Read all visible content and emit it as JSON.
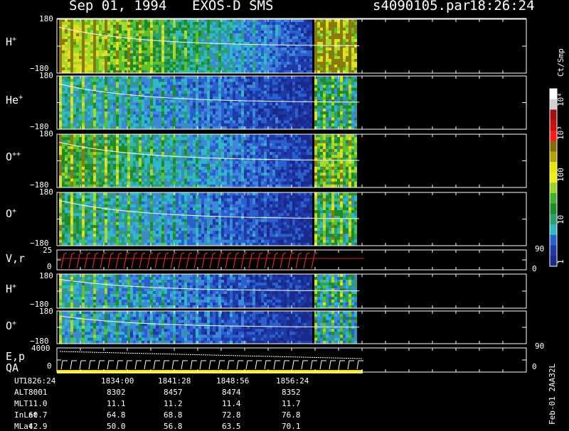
{
  "header": {
    "date": "Sep 01, 1994",
    "instrument": "EXOS-D SMS",
    "file": "s4090105.par",
    "time": "18:26:24"
  },
  "panels": [
    {
      "label": "H",
      "sup": "+",
      "top": "180",
      "bottom": "−180"
    },
    {
      "label": "He",
      "sup": "+",
      "top": "180",
      "bottom": "−180"
    },
    {
      "label": "O",
      "sup": "++",
      "top": "180",
      "bottom": "−180"
    },
    {
      "label": "O",
      "sup": "+",
      "top": "180",
      "bottom": "−180"
    },
    {
      "label": "V,r",
      "sup": "",
      "top": "25",
      "bottom": "0",
      "right_top": "90",
      "right_bottom": "0"
    },
    {
      "label": "H",
      "sup": "+",
      "top": "180",
      "bottom": "−180"
    },
    {
      "label": "O",
      "sup": "+",
      "top": "180",
      "bottom": "−180"
    },
    {
      "label": "E,p",
      "sup": "",
      "top": "4000",
      "bottom": "0",
      "right_top": "90",
      "right_bottom": "0"
    }
  ],
  "qa_label": "QA",
  "colorbar": {
    "unit": "Ct/Smp",
    "ticks": [
      "10⁴",
      "10³",
      "100",
      "10",
      "1"
    ]
  },
  "footer": {
    "rows": [
      {
        "name": "UT",
        "values": [
          "1826:24",
          "1834:00",
          "1841:28",
          "1848:56",
          "1856:24"
        ]
      },
      {
        "name": "ALT",
        "values": [
          "8001",
          "8302",
          "8457",
          "8474",
          "8352"
        ]
      },
      {
        "name": "MLT",
        "values": [
          "11.0",
          "11.1",
          "11.2",
          "11.4",
          "11.7"
        ]
      },
      {
        "name": "InLat",
        "values": [
          "60.7",
          "64.8",
          "68.8",
          "72.8",
          "76.8"
        ]
      },
      {
        "name": "MLat",
        "values": [
          "42.9",
          "50.0",
          "56.8",
          "63.5",
          "70.1"
        ]
      }
    ],
    "stamp": "Feb-01 2AA32L"
  },
  "chart_data": {
    "type": "heatmap",
    "title": "Sep 01, 1994   EXOS-D SMS",
    "x_ticks": [
      "1826:24",
      "1834:00",
      "1841:28",
      "1848:56",
      "1856:24"
    ],
    "colorscale": {
      "unit": "Ct/Smp",
      "range": [
        1,
        10000
      ],
      "scale": "log"
    },
    "panels": [
      {
        "label": "H+",
        "ylim": [
          -180,
          180
        ]
      },
      {
        "label": "He+",
        "ylim": [
          -180,
          180
        ]
      },
      {
        "label": "O++",
        "ylim": [
          -180,
          180
        ]
      },
      {
        "label": "O+",
        "ylim": [
          -180,
          180
        ]
      },
      {
        "label": "V,r",
        "ylim": [
          0,
          25
        ],
        "y2lim": [
          0,
          90
        ]
      },
      {
        "label": "H+",
        "ylim": [
          -180,
          180
        ]
      },
      {
        "label": "O+",
        "ylim": [
          -180,
          180
        ]
      },
      {
        "label": "E,p",
        "ylim": [
          0,
          4000
        ],
        "y2lim": [
          0,
          90
        ]
      }
    ]
  }
}
